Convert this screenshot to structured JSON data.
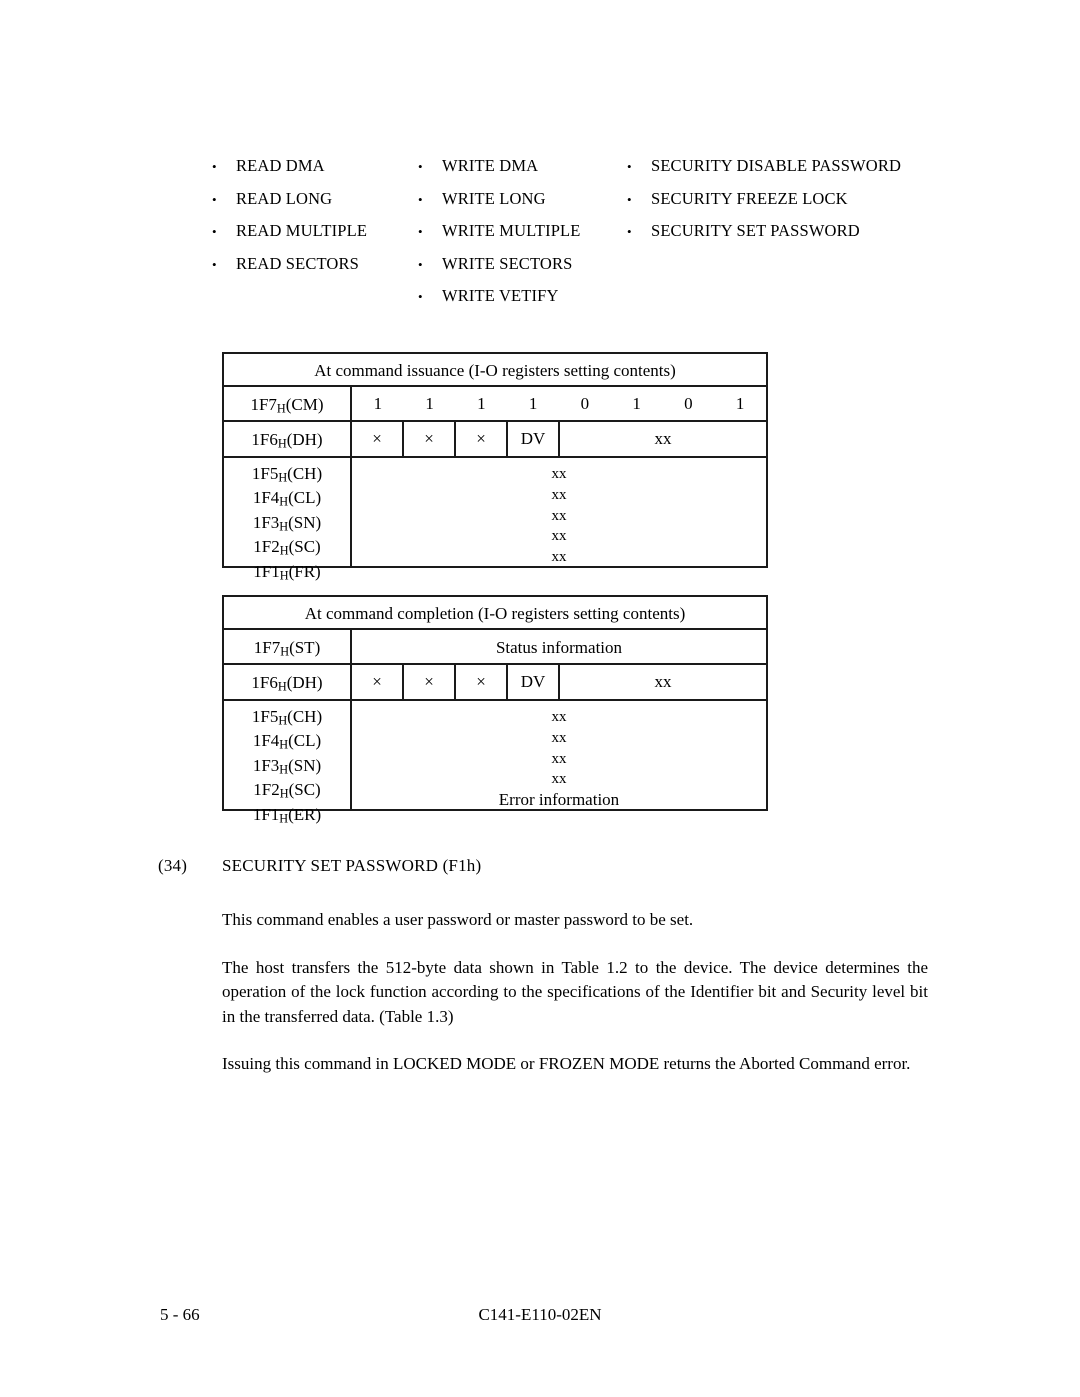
{
  "command_lists": {
    "bullet_glyph": "•",
    "columns": [
      {
        "name": "read-commands",
        "items": [
          "READ DMA",
          "READ LONG",
          "READ MULTIPLE",
          "READ SECTORS"
        ]
      },
      {
        "name": "write-commands",
        "items": [
          "WRITE DMA",
          "WRITE LONG",
          "WRITE MULTIPLE",
          "WRITE SECTORS",
          "WRITE VETIFY"
        ]
      },
      {
        "name": "security-commands",
        "items": [
          "SECURITY DISABLE PASSWORD",
          "SECURITY FREEZE LOCK",
          "SECURITY SET PASSWORD"
        ]
      }
    ]
  },
  "tables": {
    "issuance": {
      "caption": "At command issuance (I-O registers setting contents)",
      "cm_row": {
        "register": "1F7",
        "sub": "H",
        "mnemonic": "(CM)",
        "bits": [
          "1",
          "1",
          "1",
          "1",
          "0",
          "1",
          "0",
          "1"
        ]
      },
      "dh_row": {
        "register": "1F6",
        "sub": "H",
        "mnemonic": "(DH)",
        "cells": [
          "×",
          "×",
          "×",
          "DV"
        ],
        "wide_cell": "xx"
      },
      "block_rows": [
        {
          "register": "1F5",
          "sub": "H",
          "mnemonic": "(CH)",
          "value": "xx"
        },
        {
          "register": "1F4",
          "sub": "H",
          "mnemonic": "(CL)",
          "value": "xx"
        },
        {
          "register": "1F3",
          "sub": "H",
          "mnemonic": "(SN)",
          "value": "xx"
        },
        {
          "register": "1F2",
          "sub": "H",
          "mnemonic": "(SC)",
          "value": "xx"
        },
        {
          "register": "1F1",
          "sub": "H",
          "mnemonic": "(FR)",
          "value": "xx"
        }
      ]
    },
    "completion": {
      "caption": "At command completion (I-O registers setting contents)",
      "st_row": {
        "register": "1F7",
        "sub": "H",
        "mnemonic": "(ST)",
        "value": "Status information"
      },
      "dh_row": {
        "register": "1F6",
        "sub": "H",
        "mnemonic": "(DH)",
        "cells": [
          "×",
          "×",
          "×",
          "DV"
        ],
        "wide_cell": "xx"
      },
      "block_rows": [
        {
          "register": "1F5",
          "sub": "H",
          "mnemonic": "(CH)",
          "value": "xx"
        },
        {
          "register": "1F4",
          "sub": "H",
          "mnemonic": "(CL)",
          "value": "xx"
        },
        {
          "register": "1F3",
          "sub": "H",
          "mnemonic": "(SN)",
          "value": "xx"
        },
        {
          "register": "1F2",
          "sub": "H",
          "mnemonic": "(SC)",
          "value": "xx"
        },
        {
          "register": "1F1",
          "sub": "H",
          "mnemonic": "(ER)",
          "value": "Error information"
        }
      ]
    }
  },
  "section": {
    "number": "(34)",
    "title": "SECURITY SET PASSWORD (F1h)",
    "paragraph_1": "This command enables a user password or master password to be set.",
    "paragraph_2": "The host transfers the 512-byte data shown in Table 1.2 to the device.  The device determines the operation of the lock function according to the specifications of the Identifier bit and Security level bit in the transferred data.  (Table 1.3)",
    "paragraph_3": "Issuing this command in LOCKED MODE or FROZEN MODE returns the Aborted Command error."
  },
  "footer": {
    "page_number": "5 - 66",
    "document_id": "C141-E110-02EN"
  }
}
